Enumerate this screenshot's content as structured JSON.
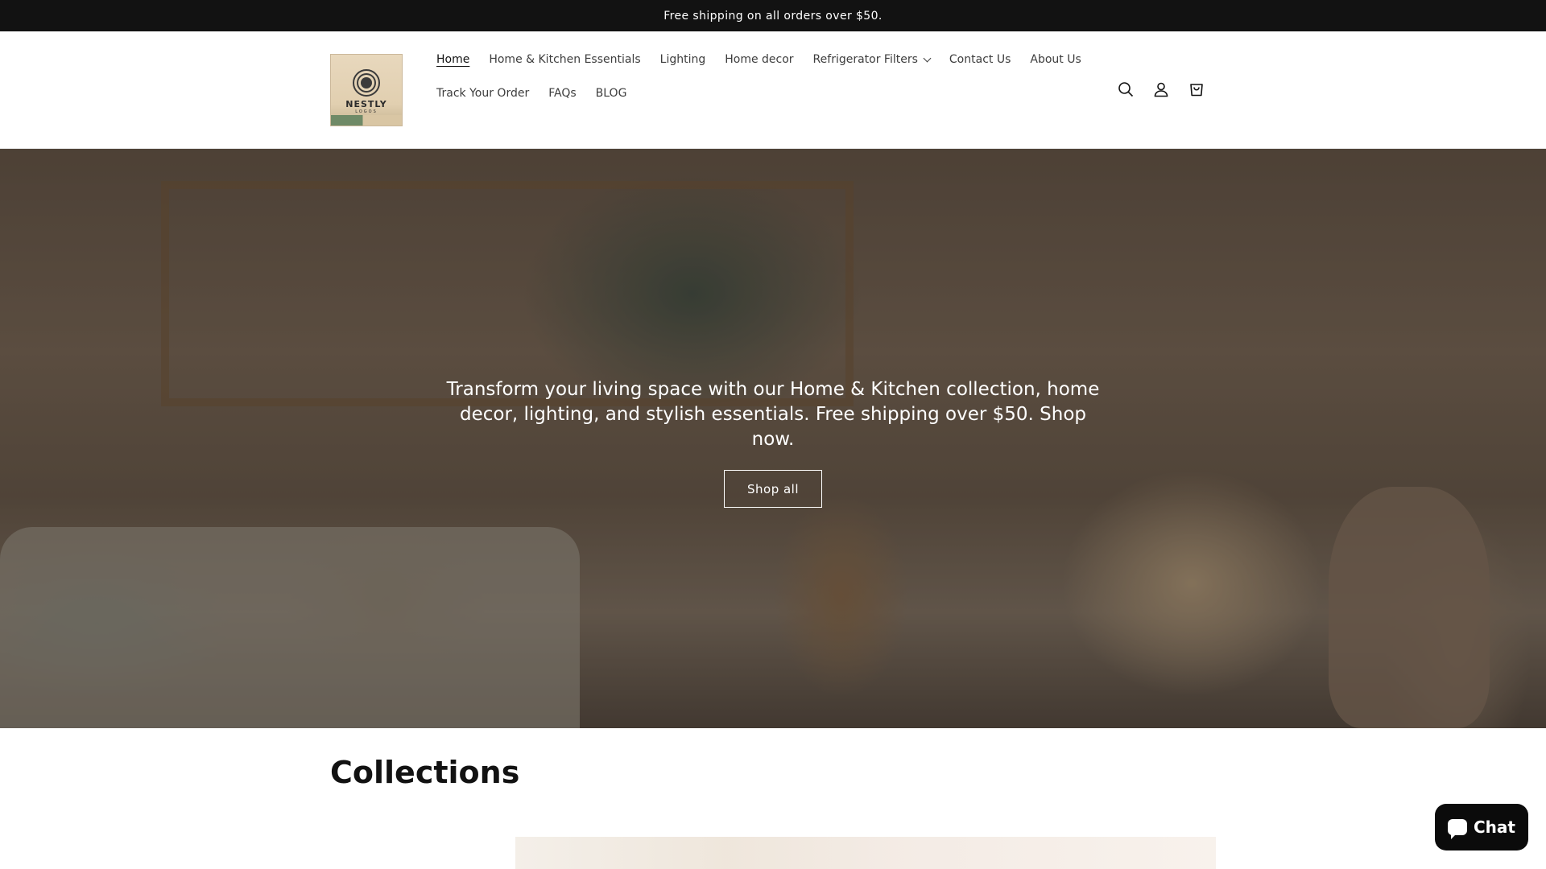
{
  "announcement": {
    "text": "Free shipping on all orders over $50."
  },
  "logo": {
    "brand": "NESTLY",
    "sub": "LOGOS"
  },
  "nav": {
    "row1": [
      {
        "label": "Home",
        "active": true
      },
      {
        "label": "Home & Kitchen Essentials"
      },
      {
        "label": "Lighting"
      },
      {
        "label": "Home decor"
      },
      {
        "label": "Refrigerator Filters",
        "has_dropdown": true
      },
      {
        "label": "Contact Us"
      },
      {
        "label": "About Us"
      }
    ],
    "row2": [
      {
        "label": "Track Your Order"
      },
      {
        "label": "FAQs"
      },
      {
        "label": "BLOG"
      }
    ]
  },
  "header_icons": [
    "search-icon",
    "account-icon",
    "cart-icon"
  ],
  "hero": {
    "text": "Transform your living space with our Home & Kitchen collection, home decor, lighting, and stylish essentials. Free shipping over $50. Shop now.",
    "button_label": "Shop all"
  },
  "collections": {
    "title": "Collections"
  },
  "chat": {
    "label": "Chat"
  }
}
